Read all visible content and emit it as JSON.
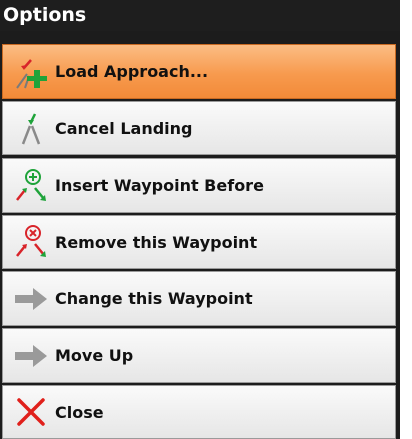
{
  "dialog": {
    "title": "Options",
    "items": [
      {
        "label": "Load Approach...",
        "icon": "approach-plane-icon",
        "selected": true
      },
      {
        "label": "Cancel Landing",
        "icon": "runway-icon",
        "selected": false
      },
      {
        "label": "Insert Waypoint Before",
        "icon": "insert-waypoint-icon",
        "selected": false
      },
      {
        "label": "Remove this Waypoint",
        "icon": "remove-waypoint-icon",
        "selected": false
      },
      {
        "label": "Change this Waypoint",
        "icon": "arrow-right-icon",
        "selected": false
      },
      {
        "label": "Move Up",
        "icon": "arrow-right-icon",
        "selected": false
      },
      {
        "label": "Close",
        "icon": "close-icon",
        "selected": false
      }
    ]
  },
  "colors": {
    "selected": "#f79a4e",
    "close_red": "#e0201b",
    "arrow_gray": "#9a9a9a",
    "green": "#1fa33a",
    "red": "#d8242a"
  }
}
